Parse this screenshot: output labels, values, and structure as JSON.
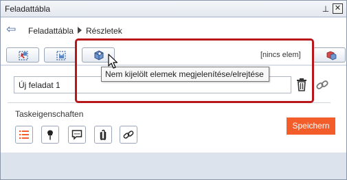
{
  "window": {
    "title": "Feladattábla",
    "pin_glyph": "⊥",
    "close_glyph": "✕"
  },
  "breadcrumb": {
    "items": [
      "Feladattábla",
      "Részletek"
    ]
  },
  "toolbar": {
    "status_text": "[nincs elem]",
    "buttons": [
      "select-elements",
      "save-selection",
      "show-hide-selected-elements",
      "3d-view"
    ]
  },
  "tooltip": {
    "text": "Nem kijelölt elemek megjelenítése/elrejtése"
  },
  "task": {
    "name_value": "Új feladat 1"
  },
  "properties": {
    "section_label": "Taskeigenschaften",
    "buttons": [
      "list-icon",
      "pin-icon",
      "comment-icon",
      "attachment-icon",
      "link-icon"
    ]
  },
  "actions": {
    "save_label": "Speichern"
  },
  "colors": {
    "accent": "#f25d2a",
    "highlight": "#b8161b",
    "icon_blue": "#3a63a0"
  }
}
